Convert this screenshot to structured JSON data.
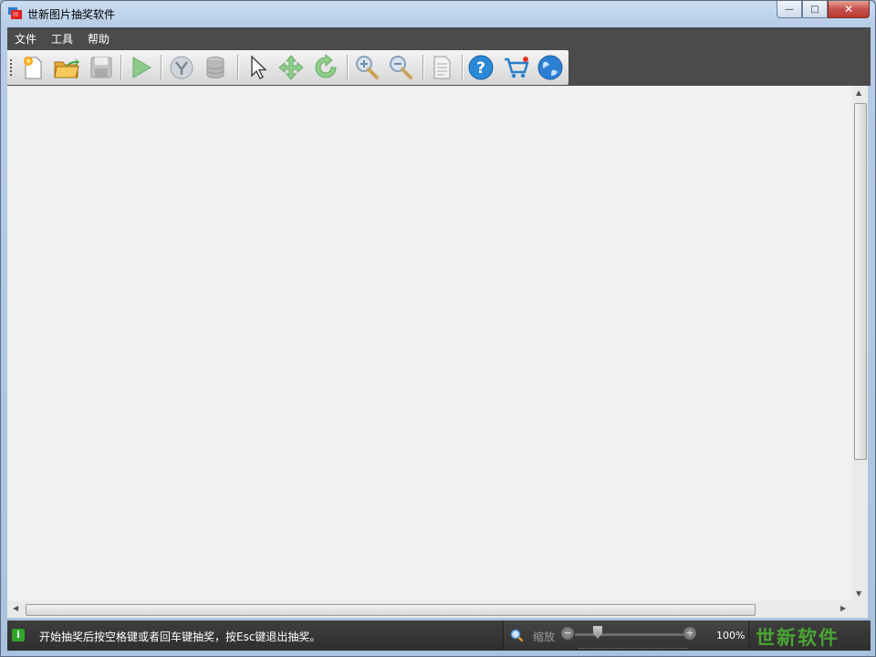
{
  "window": {
    "title": "世新图片抽奖软件",
    "buttons": {
      "minimize": "—",
      "maximize": "□",
      "close": "✕"
    }
  },
  "menu": [
    "文件",
    "工具",
    "帮助"
  ],
  "toolbar": [
    {
      "icon": "new-file-icon"
    },
    {
      "icon": "open-folder-icon"
    },
    {
      "icon": "save-icon"
    },
    {
      "icon": "play-icon"
    },
    {
      "icon": "filter-icon"
    },
    {
      "icon": "database-icon"
    },
    {
      "icon": "pointer-icon"
    },
    {
      "icon": "move-icon"
    },
    {
      "icon": "rotate-icon"
    },
    {
      "icon": "zoom-in-icon"
    },
    {
      "icon": "zoom-out-icon"
    },
    {
      "icon": "document-icon"
    },
    {
      "icon": "help-icon"
    },
    {
      "icon": "cart-icon"
    },
    {
      "icon": "globe-icon"
    }
  ],
  "status": {
    "info_icon": "i",
    "message": "开始抽奖后按空格键或者回车键抽奖，按Esc键退出抽奖。",
    "zoom_label": "缩放",
    "zoom_percent": "100%",
    "zoom_level": 0.2,
    "brand": "世新软件"
  },
  "colors": {
    "toolbar_bg": "#4b4b4b",
    "content_bg": "#f0f1f3",
    "brand_green": "#4aa534"
  }
}
